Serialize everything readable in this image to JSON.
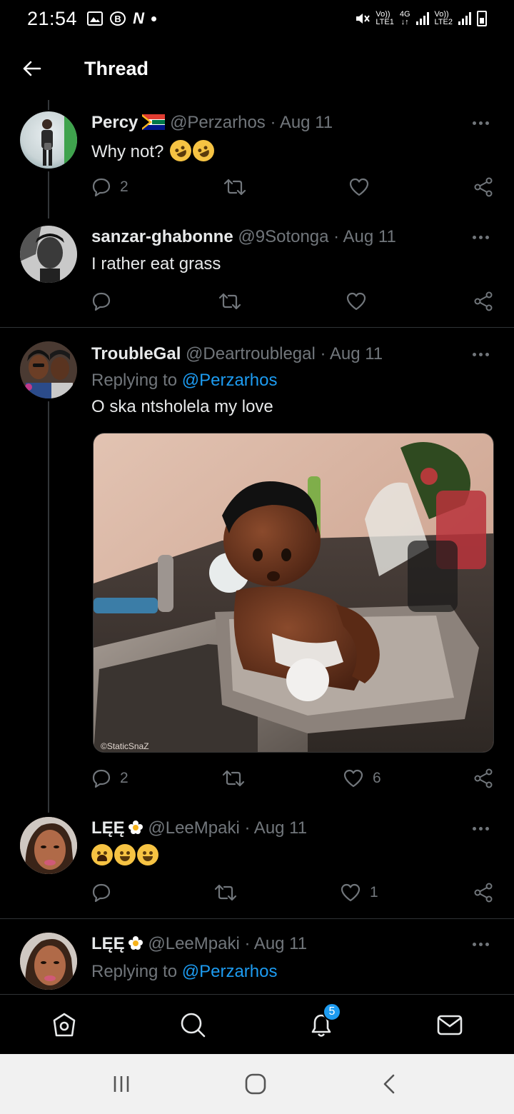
{
  "status_bar": {
    "time": "21:54",
    "left_icons": [
      "image-icon",
      "b-icon",
      "n-icon"
    ],
    "sim1_label": "Vo))",
    "sim1_sub": "LTE1",
    "net_label": "4G",
    "sim2_label": "Vo))",
    "sim2_sub": "LTE2"
  },
  "header": {
    "title": "Thread",
    "back_icon": "arrow-left-icon"
  },
  "tweets": [
    {
      "name": "Percy",
      "handle": "@Perzarhos",
      "date": "· Aug 11",
      "text": "Why not?",
      "emojis": [
        "rolling-laughing-emoji",
        "rolling-laughing-emoji"
      ],
      "replies": "2",
      "retweets": "",
      "likes": ""
    },
    {
      "name": "sanzar-ghabonne",
      "handle": "@9Sotonga",
      "date": "· Aug 11",
      "text": "I rather eat grass",
      "replies": "",
      "retweets": "",
      "likes": ""
    },
    {
      "name": "TroubleGal",
      "handle": "@Deartroublegal",
      "date": "· Aug 11",
      "reply_prefix": "Replying to ",
      "reply_to": "@Perzarhos",
      "text": "O ska ntsholela my love",
      "media_watermark": "©StaticSnaZ",
      "replies": "2",
      "retweets": "",
      "likes": "6"
    },
    {
      "name": "LĘĘ",
      "handle": "@LeeMpaki",
      "date": "· Aug 11",
      "emojis": [
        "crying-emoji",
        "tears-of-joy-emoji",
        "tears-of-joy-emoji"
      ],
      "replies": "",
      "retweets": "",
      "likes": "1"
    },
    {
      "name": "LĘĘ",
      "handle": "@LeeMpaki",
      "date": "· Aug 11",
      "reply_prefix": "Replying to ",
      "reply_to": "@Perzarhos"
    }
  ],
  "bottom_nav": {
    "items": [
      "home-icon",
      "search-icon",
      "notifications-icon",
      "messages-icon"
    ],
    "notification_count": "5"
  },
  "colors": {
    "background": "#000000",
    "text": "#e7e9ea",
    "secondary": "#71767b",
    "accent": "#1d9bf0"
  }
}
